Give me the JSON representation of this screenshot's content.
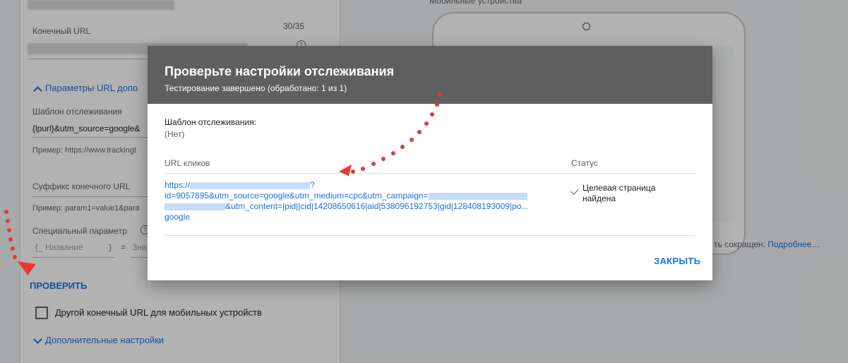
{
  "form": {
    "final_url_label": "Конечный URL",
    "final_url_counter": "30/35",
    "url_params_toggle": "Параметры URL допо",
    "tracking_template_label": "Шаблон отслеживания",
    "tracking_template_value": "{lpurl}&utm_source=google&",
    "tracking_example": "Пример: https://www.trackingt",
    "final_url_suffix_label": "Суффикс конечного URL",
    "suffix_example": "Пример: param1=value1&para",
    "custom_param_label": "Специальный параметр",
    "custom_param_name_placeholder": "{_ Название",
    "custom_param_close": "}",
    "custom_param_equals": "=",
    "custom_param_value_placeholder": "Зна",
    "check_button": "ПРОВЕРИТЬ",
    "mobile_url_checkbox": "Другой конечный URL для мобильных устройств",
    "additional_settings": "Дополнительные настройки"
  },
  "preview": {
    "mobile_label": "Мобильные устройства",
    "truncated_note": "ть сокращен.",
    "more_link": "Подробнее…"
  },
  "dialog": {
    "title": "Проверьте настройки отслеживания",
    "subtitle": "Тестирование завершено (обработано: 1 из 1)",
    "template_label": "Шаблон отслеживания:",
    "template_value": "(Нет)",
    "col_url": "URL кликов",
    "col_status": "Статус",
    "url_line1": "https://",
    "url_line1_end": "?",
    "url_line2": "id=9057895&utm_source=google&utm_medium=cpc&utm_campaign=",
    "url_line3": "&utm_content=|pid||cid|14208650616|aid|538096192753|gid|128408193009|po...",
    "url_line4": "google",
    "status_text": "Целевая страница найдена",
    "close_button": "ЗАКРЫТЬ"
  },
  "colors": {
    "accent": "#1a73e8",
    "success": "#188038",
    "header_bg": "#5f5f5f",
    "annotation": "#e53935"
  }
}
